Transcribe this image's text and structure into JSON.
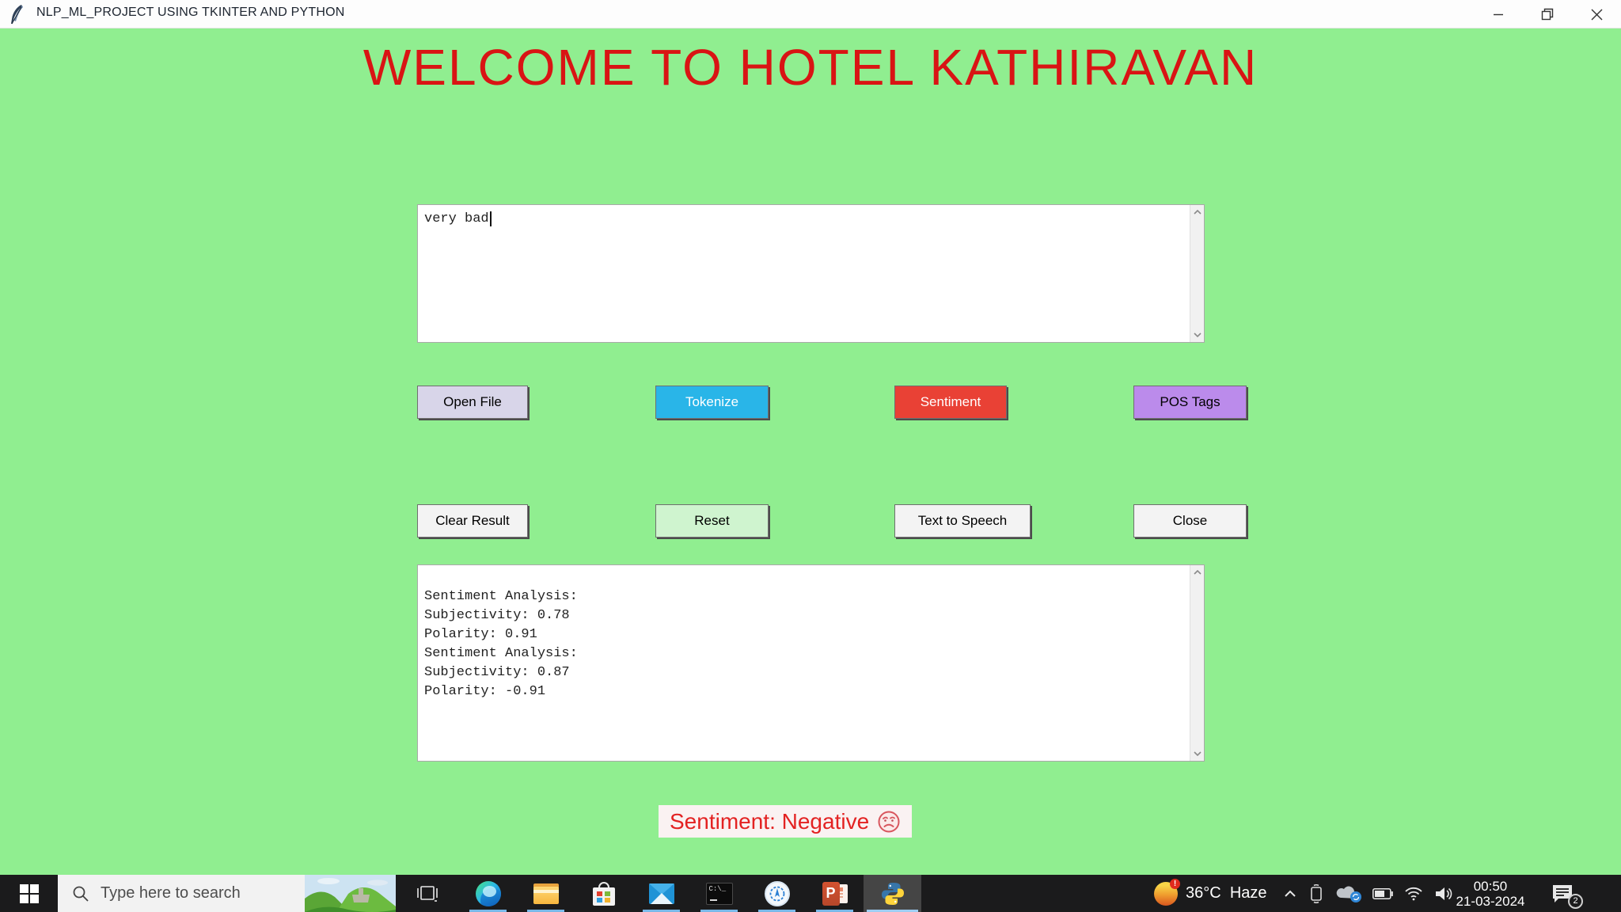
{
  "window": {
    "title": "NLP_ML_PROJECT USING TKINTER AND PYTHON",
    "icon": "tkinter-feather-icon",
    "controls": [
      "minimize",
      "restore",
      "close"
    ]
  },
  "app": {
    "background_color": "#90EE90",
    "heading": {
      "text": "WELCOME TO HOTEL KATHIRAVAN",
      "color": "#D91414"
    },
    "input_area": {
      "value": "very bad",
      "cursor_visible": true
    },
    "action_buttons": [
      {
        "label": "Open File",
        "bg": "#D8D5E9",
        "fg": "#000000"
      },
      {
        "label": "Tokenize",
        "bg": "#29B5E8",
        "fg": "#FFFFFF"
      },
      {
        "label": "Sentiment",
        "bg": "#E94135",
        "fg": "#FFFFFF"
      },
      {
        "label": "POS Tags",
        "bg": "#BB8BEB",
        "fg": "#000000"
      }
    ],
    "utility_buttons": [
      {
        "label": "Clear Result",
        "bg": "#F3F3F3",
        "fg": "#000000"
      },
      {
        "label": "Reset",
        "bg": "#CFF4CF",
        "fg": "#000000"
      },
      {
        "label": "Text to Speech",
        "bg": "#F3F3F3",
        "fg": "#000000"
      },
      {
        "label": "Close",
        "bg": "#F3F3F3",
        "fg": "#000000"
      }
    ],
    "results_area": {
      "text": "Sentiment Analysis:\nSubjectivity: 0.78\nPolarity: 0.91\nSentiment Analysis:\nSubjectivity: 0.87\nPolarity: -0.91"
    },
    "sentiment_result": {
      "text": "Sentiment: Negative",
      "emoji": "sad-face-icon",
      "color": "#E32222"
    }
  },
  "taskbar": {
    "search": {
      "placeholder": "Type here to search",
      "icon": "search-icon"
    },
    "apps": [
      {
        "name": "task-view",
        "running": false
      },
      {
        "name": "microsoft-edge",
        "running": true
      },
      {
        "name": "file-explorer",
        "running": true
      },
      {
        "name": "microsoft-store",
        "running": false
      },
      {
        "name": "mail",
        "running": false
      },
      {
        "name": "terminal",
        "running": true
      },
      {
        "name": "app-badge",
        "running": true
      },
      {
        "name": "powerpoint",
        "running": true
      },
      {
        "name": "python-app",
        "running": true,
        "active": true
      }
    ],
    "tray": {
      "weather_temp": "36°C",
      "weather_cond": "Haze",
      "icons": [
        "chevron-up-icon",
        "phone-link-icon",
        "cloud-sync-icon",
        "battery-icon",
        "wifi-icon",
        "volume-icon"
      ],
      "time": "00:50",
      "date": "21-03-2024",
      "notification_count": "2"
    }
  }
}
